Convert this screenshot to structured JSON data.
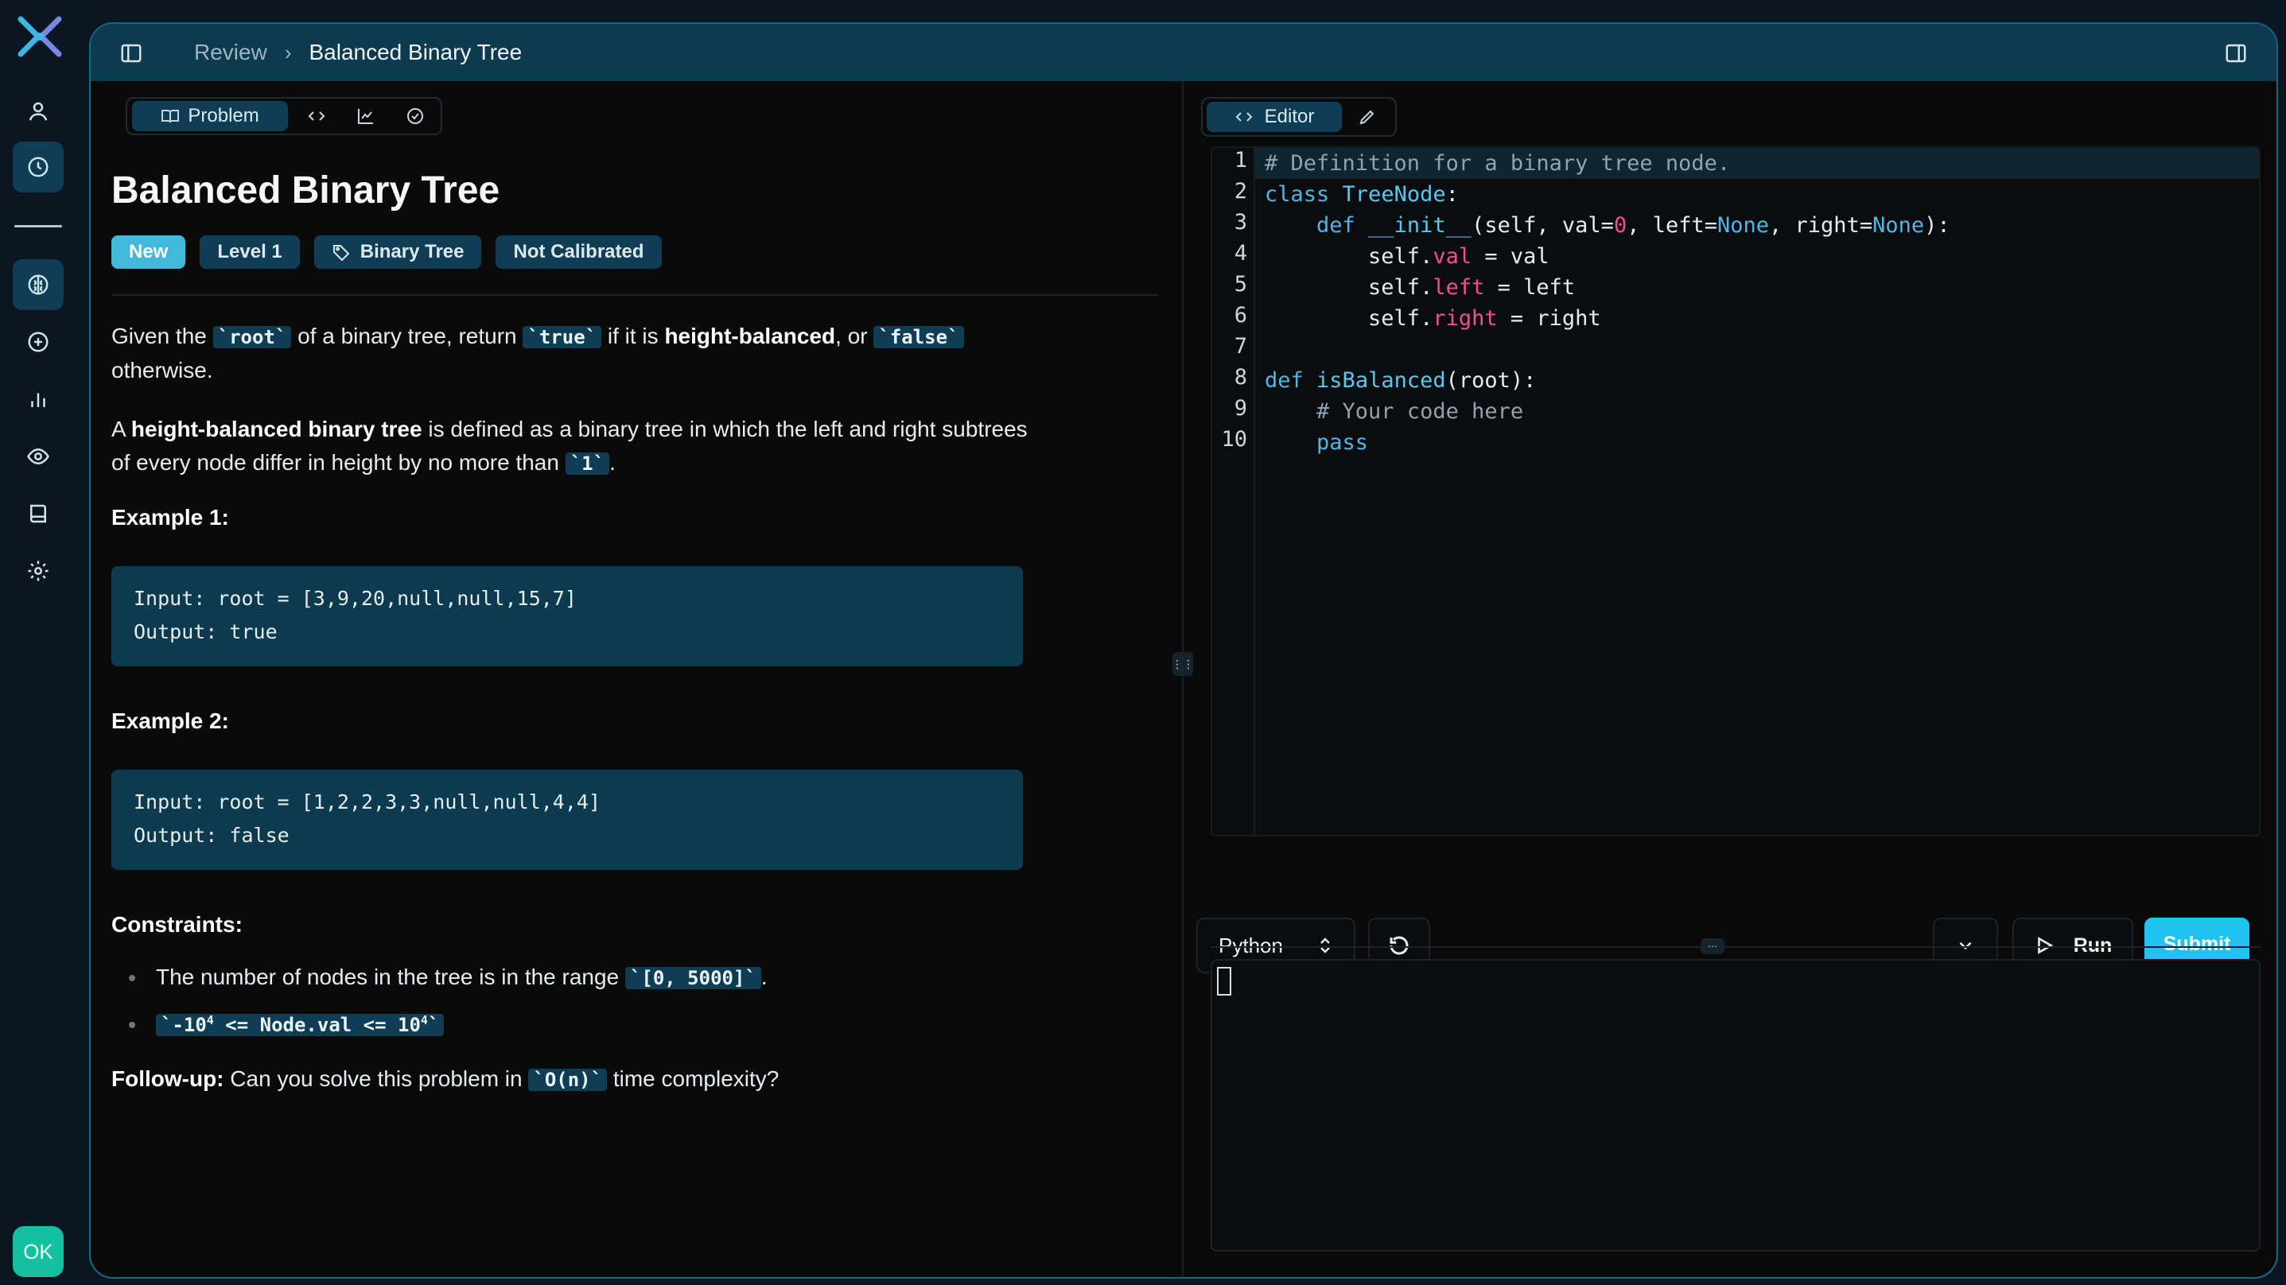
{
  "app": {
    "rail": {
      "status_badge": "OK"
    },
    "breadcrumb": {
      "parent": "Review",
      "current": "Balanced Binary Tree"
    }
  },
  "problem": {
    "tabs": {
      "active_label": "Problem"
    },
    "title": "Balanced Binary Tree",
    "badges": {
      "status": "New",
      "level": "Level 1",
      "topic": "Binary Tree",
      "calibration": "Not Calibrated"
    },
    "description": {
      "p1_part1": "Given the ",
      "p1_code1": "`root`",
      "p1_part2": " of a binary tree, return ",
      "p1_code2": "`true`",
      "p1_part3": " if it is ",
      "p1_bold": "height-balanced",
      "p1_part4": ", or ",
      "p1_code3": "`false`",
      "p1_part5": " otherwise.",
      "p2_part1": "A ",
      "p2_bold": "height-balanced binary tree",
      "p2_part2": " is defined as a binary tree in which the left and right subtrees of every node differ in height by no more than ",
      "p2_code": "`1`",
      "p2_part3": "."
    },
    "examples": [
      {
        "title": "Example 1:",
        "input": "Input: root = [3,9,20,null,null,15,7]",
        "output": "Output: true"
      },
      {
        "title": "Example 2:",
        "input": "Input: root = [1,2,2,3,3,null,null,4,4]",
        "output": "Output: false"
      }
    ],
    "constraints": {
      "title": "Constraints:",
      "c1_text": "The number of nodes in the tree is in the range ",
      "c1_code": "`[0, 5000]`",
      "c1_end": ".",
      "c2_a": "`-10",
      "c2_exp1": "4",
      "c2_b": " <= Node.val <= 10",
      "c2_exp2": "4",
      "c2_c": "`"
    },
    "followup": {
      "label": "Follow-up:",
      "text1": " Can you solve this problem in ",
      "code": "`O(n)`",
      "text2": " time complexity?"
    }
  },
  "editor": {
    "tab_label": "Editor",
    "line_numbers": [
      "1",
      "2",
      "3",
      "4",
      "5",
      "6",
      "7",
      "8",
      "9",
      "10"
    ],
    "language": "Python",
    "run_label": "Run",
    "submit_label": "Submit"
  },
  "colors": {
    "accent": "#43b7dc",
    "submit": "#1ec3f2",
    "frame_border": "#0f6a86",
    "topbar": "#0c3a4f",
    "ok_badge": "#14c0a0"
  }
}
